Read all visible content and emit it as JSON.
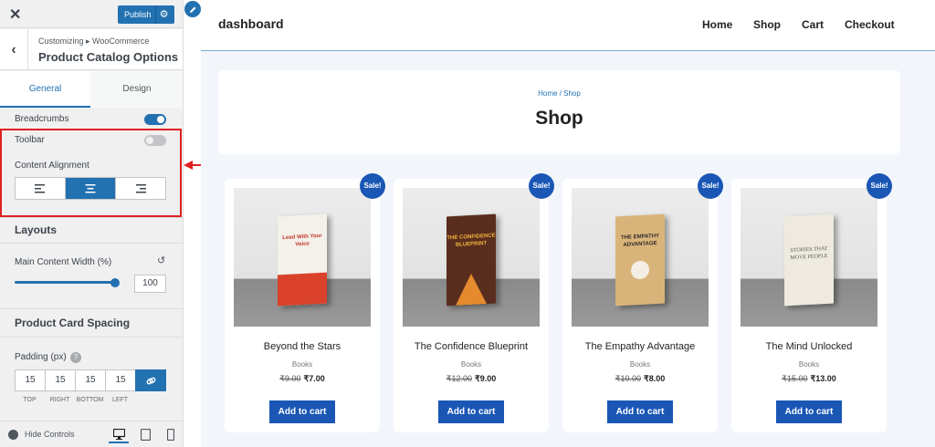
{
  "customizer": {
    "close_icon": "close-icon",
    "publish_label": "Publish",
    "breadcrumb": "Customizing ▸ WooCommerce",
    "section_title": "Product Catalog Options",
    "tabs": [
      {
        "label": "General",
        "active": true
      },
      {
        "label": "Design",
        "active": false
      }
    ],
    "breadcrumbs_label": "Breadcrumbs",
    "breadcrumbs_enabled": true,
    "toolbar_label": "Toolbar",
    "toolbar_enabled": false,
    "content_alignment_label": "Content Alignment",
    "content_alignment_selected": "center",
    "layouts_heading": "Layouts",
    "main_content_width_label": "Main Content Width (%)",
    "main_content_width_value": "100",
    "product_card_spacing_heading": "Product Card Spacing",
    "padding_label": "Padding (px)",
    "padding": {
      "values": [
        "15",
        "15",
        "15",
        "15"
      ],
      "labels": [
        "TOP",
        "RIGHT",
        "BOTTOM",
        "LEFT"
      ]
    },
    "hide_controls_label": "Hide Controls",
    "devices": [
      "desktop",
      "tablet",
      "mobile"
    ]
  },
  "preview": {
    "site_title": "dashboard",
    "nav": [
      "Home",
      "Shop",
      "Cart",
      "Checkout"
    ],
    "breadcrumb": "Home / Shop",
    "page_title": "Shop",
    "sale_badge": "Sale!",
    "add_to_cart": "Add to cart",
    "products": [
      {
        "name": "Beyond the Stars",
        "category": "Books",
        "old_price": "₹9.00",
        "price": "₹7.00",
        "cover_text": "Lead With Your Voice"
      },
      {
        "name": "The Confidence Blueprint",
        "category": "Books",
        "old_price": "₹12.00",
        "price": "₹9.00",
        "cover_text": "THE CONFIDENCE BLUEPRINT"
      },
      {
        "name": "The Empathy Advantage",
        "category": "Books",
        "old_price": "₹10.00",
        "price": "₹8.00",
        "cover_text": "THE EMPATHY ADVANTAGE"
      },
      {
        "name": "The Mind Unlocked",
        "category": "Books",
        "old_price": "₹15.00",
        "price": "₹13.00",
        "cover_text": "STORIES THAT MOVE PEOPLE"
      }
    ]
  },
  "colors": {
    "accent": "#2271b1",
    "sale_blue": "#1a57b5",
    "highlight_red": "#e02020"
  }
}
